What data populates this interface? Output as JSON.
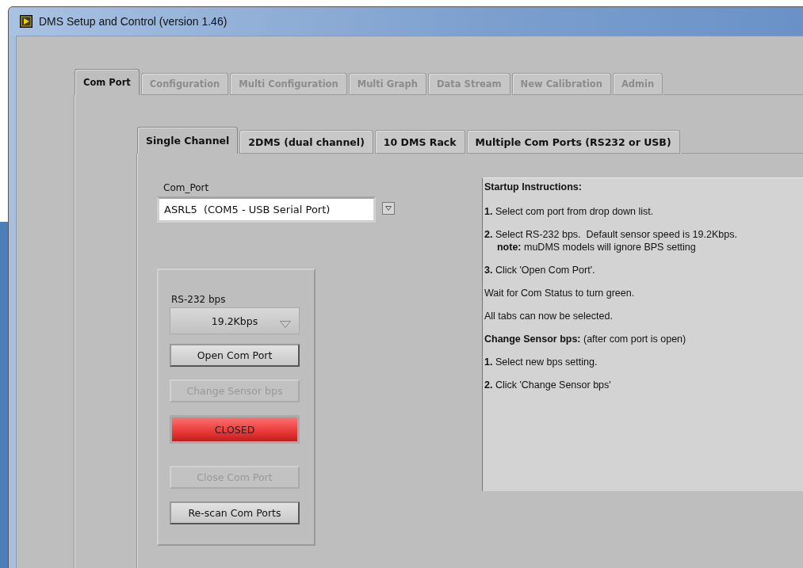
{
  "window": {
    "title": "DMS Setup and Control (version 1.46)"
  },
  "tabs": [
    {
      "label": "Com Port",
      "selected": true
    },
    {
      "label": "Configuration",
      "selected": false
    },
    {
      "label": "Multi Configuration",
      "selected": false
    },
    {
      "label": "Multi Graph",
      "selected": false
    },
    {
      "label": "Data Stream",
      "selected": false
    },
    {
      "label": "New Calibration",
      "selected": false
    },
    {
      "label": "Admin",
      "selected": false
    }
  ],
  "subtabs": [
    {
      "label": "Single Channel",
      "selected": true
    },
    {
      "label": "2DMS (dual channel)",
      "selected": false
    },
    {
      "label": "10 DMS Rack",
      "selected": false
    },
    {
      "label": "Multiple Com Ports (RS232 or USB)",
      "selected": false
    }
  ],
  "com_port": {
    "label": "Com_Port",
    "value": "ASRL5  (COM5 - USB Serial Port)"
  },
  "controls": [
    {
      "kind": "label",
      "text": "RS-232 bps"
    },
    {
      "kind": "dropdown",
      "text": "19.2Kbps",
      "disabled": false
    },
    {
      "kind": "button",
      "text": "Open Com Port",
      "disabled": false
    },
    {
      "kind": "button",
      "text": "Change Sensor bps",
      "disabled": true
    },
    {
      "kind": "indicator",
      "text": "CLOSED",
      "on": false
    },
    {
      "kind": "button",
      "text": "Close Com Port",
      "disabled": true
    },
    {
      "kind": "button",
      "text": "Re-scan Com Ports",
      "disabled": false
    }
  ],
  "instructions": [
    {
      "kind": "heading",
      "text": "Startup Instructions:"
    },
    {
      "kind": "line",
      "text": "**1.** Select com port from drop down list."
    },
    {
      "kind": "line",
      "text": "**2.** Select RS-232 bps.  Default sensor speed is 19.2Kbps."
    },
    {
      "kind": "note",
      "text": "**note:** muDMS models will ignore BPS setting"
    },
    {
      "kind": "line",
      "text": "**3.** Click 'Open Com Port'."
    },
    {
      "kind": "line",
      "text": "Wait for Com Status to turn green."
    },
    {
      "kind": "line",
      "text": "All tabs can now be selected."
    },
    {
      "kind": "line",
      "text": "**Change Sensor bps:** (after com port is open)"
    },
    {
      "kind": "line",
      "text": "**1.** Select new bps setting."
    },
    {
      "kind": "line",
      "text": "**2.** Click 'Change Sensor bps'"
    }
  ]
}
